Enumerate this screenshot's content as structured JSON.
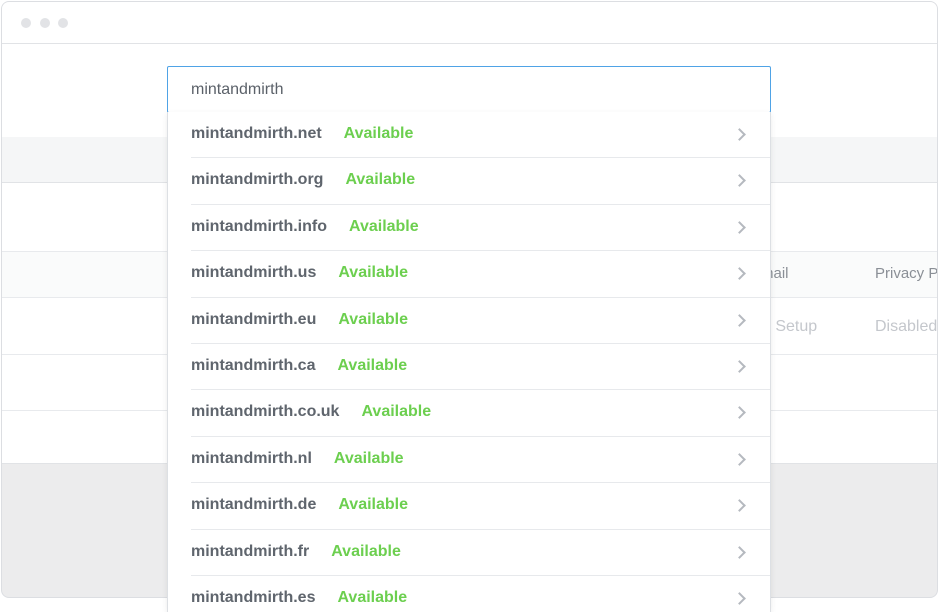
{
  "search": {
    "value": "mintandmirth",
    "placeholder": ""
  },
  "background_table": {
    "headers": [
      {
        "id": "email",
        "label": "Email"
      },
      {
        "id": "privacy",
        "label": "Privacy P"
      }
    ],
    "row": [
      {
        "id": "email",
        "value": "Not Setup"
      },
      {
        "id": "privacy",
        "value": "Disabled"
      }
    ]
  },
  "results": [
    {
      "domain": "mintandmirth.net",
      "status": "Available"
    },
    {
      "domain": "mintandmirth.org",
      "status": "Available"
    },
    {
      "domain": "mintandmirth.info",
      "status": "Available"
    },
    {
      "domain": "mintandmirth.us",
      "status": "Available"
    },
    {
      "domain": "mintandmirth.eu",
      "status": "Available"
    },
    {
      "domain": "mintandmirth.ca",
      "status": "Available"
    },
    {
      "domain": "mintandmirth.co.uk",
      "status": "Available"
    },
    {
      "domain": "mintandmirth.nl",
      "status": "Available"
    },
    {
      "domain": "mintandmirth.de",
      "status": "Available"
    },
    {
      "domain": "mintandmirth.fr",
      "status": "Available"
    },
    {
      "domain": "mintandmirth.es",
      "status": "Available"
    }
  ],
  "colors": {
    "available": "#6ccf4f",
    "input_focus_border": "#4fa3e6",
    "domain_text": "#5f656d"
  },
  "icons": {
    "row_arrow": "chevron-right-icon"
  }
}
